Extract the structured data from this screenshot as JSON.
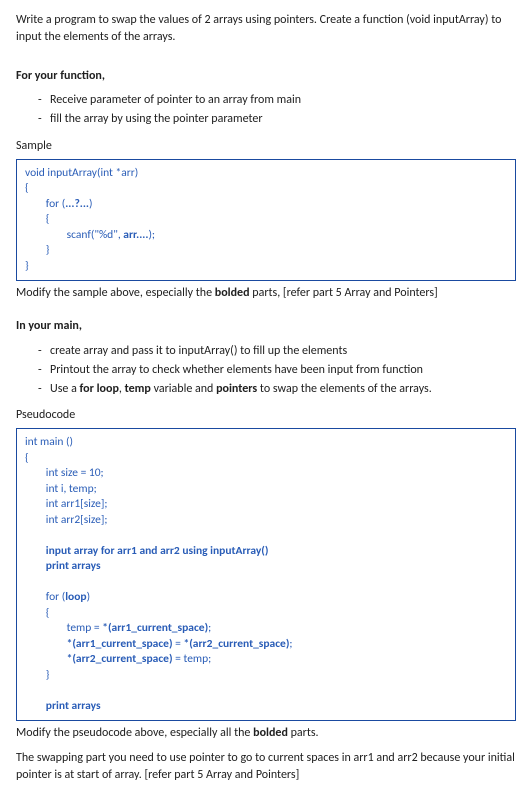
{
  "intro": {
    "p1": "Write a program to swap the values of 2 arrays using pointers. Create a function (void inputArray) to input the elements of the arrays."
  },
  "func": {
    "heading": "For your function,",
    "li1": "Receive parameter of pointer to an array from main",
    "li2": "fill the array by using the pointer parameter",
    "sample_label": "Sample",
    "code": {
      "l1": "void inputArray(int *arr)",
      "l2": "{",
      "l3": "        for (",
      "l3b": "...?...",
      "l3c": ")",
      "l4": "        {",
      "l5": "                scanf(\"%d\", ",
      "l5b": "arr....",
      "l5c": ");",
      "l6": "        }",
      "l7": "}"
    },
    "after_pre": "Modify the sample above, especially the ",
    "after_bold": "bolded",
    "after_post": " parts, [refer part 5 Array and Pointers]"
  },
  "main": {
    "heading": "In your main,",
    "li1": "create array and pass it to inputArray() to fill up the elements",
    "li2": "Printout the array to check whether elements have been input from function",
    "li3_pre": "Use a ",
    "li3_b1": "for loop",
    "li3_mid1": ", ",
    "li3_b2": "temp",
    "li3_mid2": " variable and ",
    "li3_b3": "pointers",
    "li3_post": " to swap the elements of the arrays.",
    "pseudo_label": "Pseudocode",
    "code": {
      "l1": "int main ()",
      "l2": "{",
      "l3": "        int size = 10;",
      "l4": "        int i, temp;",
      "l5": "        int arr1[size];",
      "l6": "        int arr2[size];",
      "l7": "",
      "l8": "        input array for arr1 and arr2 using inputArray()",
      "l9": "        print arrays",
      "l10": "",
      "l11": "        for (",
      "l11b": "loop",
      "l11c": ")",
      "l12": "        {",
      "l13_pre": "                temp = ",
      "l13_b": "*(arr1_current_space)",
      "l13_post": ";",
      "l14_pre": "                ",
      "l14_b1": "*(arr1_current_space)",
      "l14_mid": " = ",
      "l14_b2": "*(arr2_current_space)",
      "l14_post": ";",
      "l15_pre": "                ",
      "l15_b": "*(arr2_current_space)",
      "l15_post": " = temp;",
      "l16": "        }",
      "l17": "",
      "l18": "        print arrays"
    },
    "after_pre": "Modify the pseudocode above, especially all the ",
    "after_bold": "bolded",
    "after_post": " parts.",
    "final": "The swapping part you need to use pointer to go to current spaces in arr1 and arr2 because your initial pointer is at start of array. [refer part 5 Array and Pointers]"
  }
}
